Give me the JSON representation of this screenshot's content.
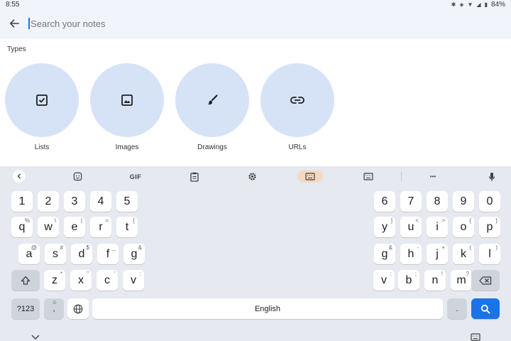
{
  "status": {
    "time": "8:55",
    "battery": "84%"
  },
  "search": {
    "placeholder": "Search your notes"
  },
  "types": {
    "heading": "Types",
    "items": [
      {
        "label": "Lists",
        "icon": "checkbox-icon"
      },
      {
        "label": "Images",
        "icon": "image-icon"
      },
      {
        "label": "Drawings",
        "icon": "brush-icon"
      },
      {
        "label": "URLs",
        "icon": "link-icon"
      }
    ]
  },
  "keyboard": {
    "toolbar": {
      "gif_label": "GIF",
      "more": "•••"
    },
    "numbers_left": [
      "1",
      "2",
      "3",
      "4",
      "5"
    ],
    "numbers_right": [
      "6",
      "7",
      "8",
      "9",
      "0"
    ],
    "row_q_left": [
      [
        "q",
        "%"
      ],
      [
        "w",
        "\\"
      ],
      [
        "e",
        "|"
      ],
      [
        "r",
        "="
      ],
      [
        "t",
        "["
      ]
    ],
    "row_q_right": [
      [
        "y",
        "]"
      ],
      [
        "u",
        "<"
      ],
      [
        "i",
        ">"
      ],
      [
        "o",
        "{"
      ],
      [
        "p",
        "}"
      ]
    ],
    "row_a_left": [
      [
        "a",
        "@"
      ],
      [
        "s",
        "#"
      ],
      [
        "d",
        "$"
      ],
      [
        "f",
        "_"
      ],
      [
        "g",
        "&"
      ]
    ],
    "row_a_right": [
      [
        "h",
        "-"
      ],
      [
        "j",
        "+"
      ],
      [
        "k",
        "("
      ],
      [
        "l",
        ")"
      ]
    ],
    "row_z_left": [
      [
        "z",
        "*"
      ],
      [
        "x",
        "\""
      ],
      [
        "c",
        "'"
      ],
      [
        "v",
        ":"
      ]
    ],
    "row_z_right": [
      [
        "b",
        ";"
      ],
      [
        "n",
        "!"
      ],
      [
        "m",
        "?"
      ]
    ],
    "g_sub": "&",
    "right_g": [
      "g",
      "&"
    ],
    "right_v": [
      "v",
      ":"
    ],
    "symbols_label": "?123",
    "comma_label": ",",
    "comma_sub": "☺",
    "space_label": "English",
    "period_label": ".",
    "colors": {
      "accent": "#1a73e8",
      "key": "#ffffff",
      "func_key": "#cfd4dc",
      "chip": "#d6e3f7"
    }
  }
}
